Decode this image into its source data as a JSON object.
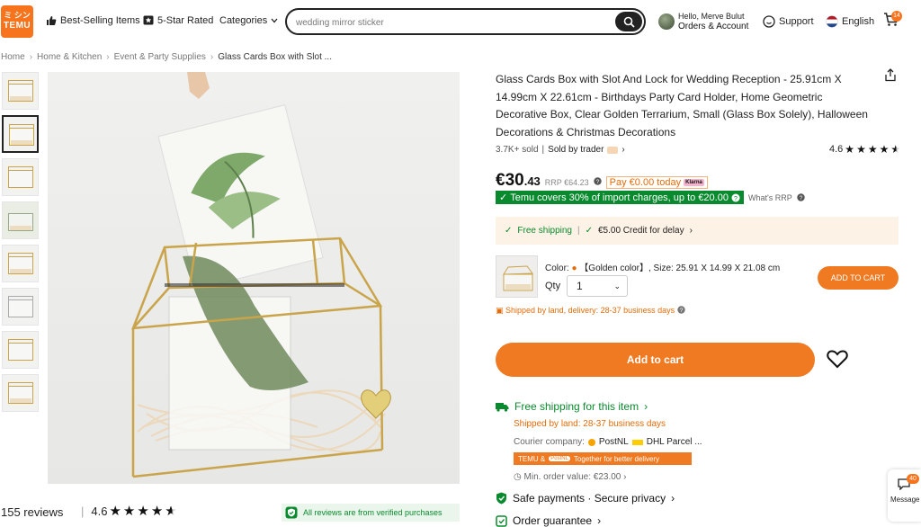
{
  "header": {
    "logo_top": "ミ シン",
    "logo_bottom": "TEMU",
    "best_selling": "Best-Selling Items",
    "five_star": "5-Star Rated",
    "categories": "Categories",
    "search_placeholder": "wedding mirror sticker",
    "account_greeting": "Hello, Merve Bulut",
    "account_label": "Orders & Account",
    "support": "Support",
    "language": "English",
    "cart_count": "14"
  },
  "breadcrumb": [
    "Home",
    "Home & Kitchen",
    "Event & Party Supplies",
    "Glass Cards Box with Slot ..."
  ],
  "product": {
    "title": "Glass Cards Box with Slot And Lock for Wedding Reception - 25.91cm X 14.99cm X 22.61cm - Birthdays Party Card Holder, Home Geometric Decorative Box, Clear Golden Terrarium, Small (Glass Box Solely), Halloween Decorations & Christmas Decorations",
    "sold": "3.7K+ sold",
    "sold_by": "Sold by trader",
    "rating": "4.6",
    "price_main": "€30",
    "price_decimal": ".43",
    "rrp": "RRP €64.23",
    "pay_today": "Pay €0.00 today",
    "klarna": "Klarna",
    "import_note": "Temu covers 30% of import charges, up to €20.00",
    "whats_rrp": "What's RRP",
    "free_shipping": "Free shipping",
    "credit_delay": "€5.00 Credit for delay",
    "color_label": "Color:",
    "color_value": "【Golden color】, Size: 25.91 X 14.99 X 21.08 cm",
    "qty_label": "Qty",
    "qty_value": "1",
    "add_to_cart_small": "ADD TO CART",
    "shipped_land": "Shipped by land, delivery: 28-37 business days",
    "add_to_cart": "Add to cart"
  },
  "shipping": {
    "title": "Free shipping for this item",
    "by_land": "Shipped by land: 28-37 business days",
    "courier_label": "Courier company:",
    "courier_1": "PostNL",
    "courier_2": "DHL Parcel ...",
    "temu_bar_brand": "TEMU &",
    "temu_bar_partner": "PostNL",
    "temu_bar_text": "Together for better delivery",
    "min_order": "Min. order value: €23.00"
  },
  "assurances": {
    "safe": "Safe payments · Secure privacy",
    "order_guarantee": "Order guarantee"
  },
  "reviews": {
    "count": "155 reviews",
    "rating": "4.6",
    "verified": "All reviews are from verified purchases"
  },
  "floating": {
    "messages_badge": "40",
    "messages_label": "Message"
  },
  "colors": {
    "brand_orange": "#f07a22",
    "trust_green": "#0a8a2e",
    "ship_box_bg": "#fdf2e6"
  }
}
